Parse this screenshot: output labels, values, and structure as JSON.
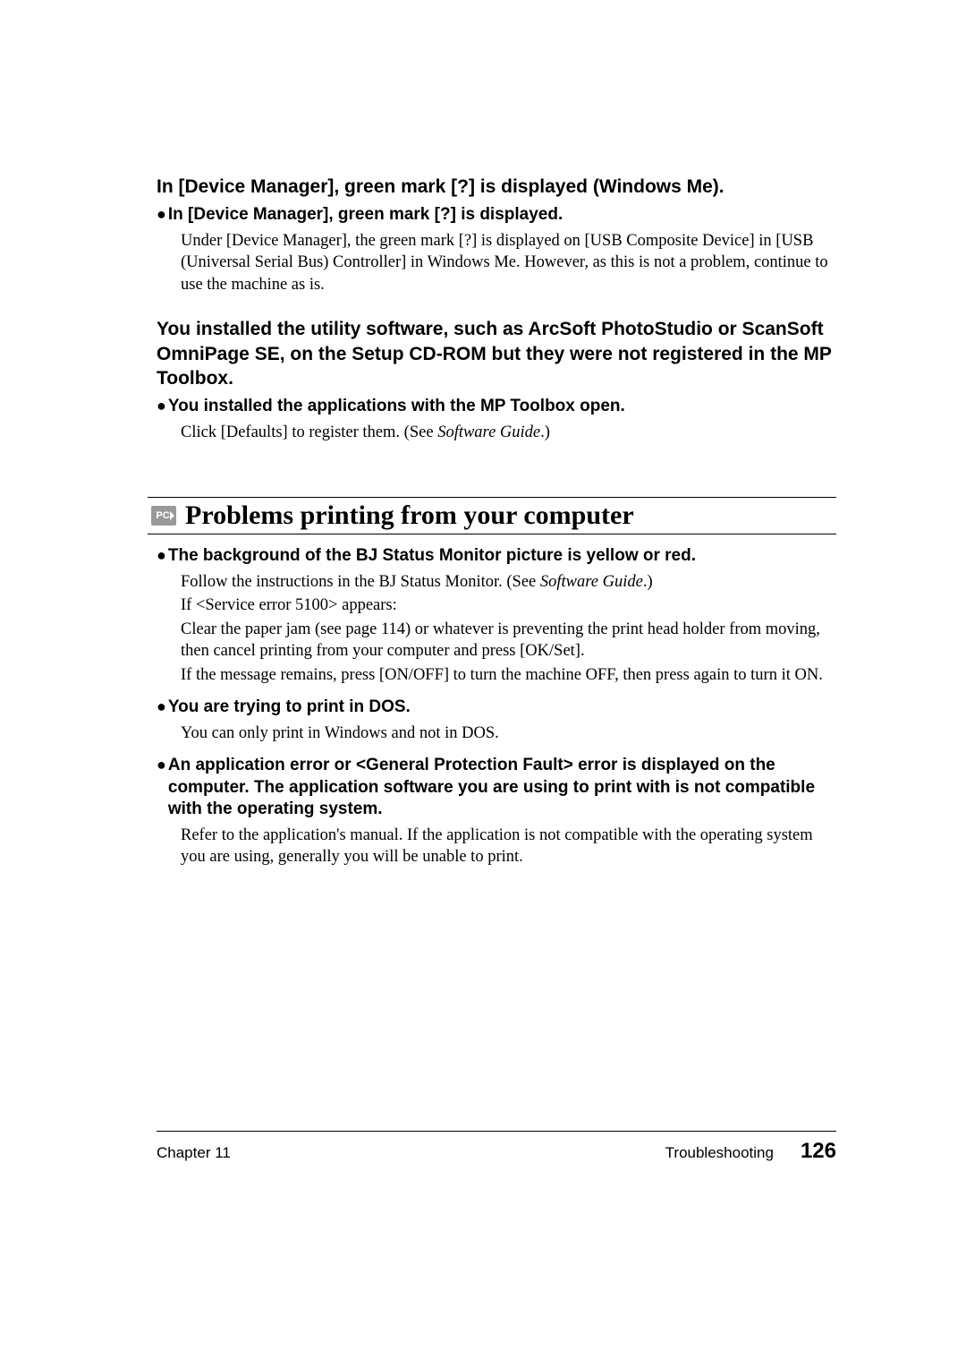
{
  "sec1": {
    "heading": "In [Device Manager], green mark [?] is displayed (Windows Me).",
    "sub1": "In [Device Manager], green mark [?] is displayed.",
    "body1": "Under [Device Manager], the green mark [?] is displayed on [USB Composite Device] in [USB (Universal Serial Bus) Controller] in Windows Me. However, as this is not a problem, continue to use the machine as is."
  },
  "sec2": {
    "heading": "You installed the utility software, such as ArcSoft PhotoStudio or ScanSoft OmniPage SE, on the Setup CD-ROM but they were not registered in the MP Toolbox.",
    "sub1": "You installed the applications with the MP Toolbox open.",
    "body1a": "Click [Defaults] to register them. (See ",
    "body1b_italic": "Software Guide",
    "body1c": ".)"
  },
  "bigtitle": {
    "badge": "PC",
    "text": "Problems printing from your computer"
  },
  "sec3": {
    "sub1": "The background of the BJ Status Monitor picture is yellow or red.",
    "body1a": "Follow the instructions in the BJ Status Monitor. (See ",
    "body1b_italic": "Software Guide",
    "body1c": ".)",
    "body2": "If <Service error 5100> appears:",
    "body3": "Clear the paper jam (see page 114) or whatever is preventing the print head holder from moving, then cancel printing from your computer and press [OK/Set].",
    "body4": "If the message remains, press [ON/OFF] to turn the machine OFF, then press again to turn it ON.",
    "sub2": "You are trying to print in DOS.",
    "body5": "You can only print in Windows and not in DOS.",
    "sub3": "An application error or <General Protection Fault> error is displayed on the computer. The application software you are using to print with is not compatible with the operating system.",
    "body6": "Refer to the application's manual. If the application is not compatible with the operating system you are using, generally you will be unable to print."
  },
  "footer": {
    "left": "Chapter 11",
    "right_label": "Troubleshooting",
    "page": "126"
  }
}
